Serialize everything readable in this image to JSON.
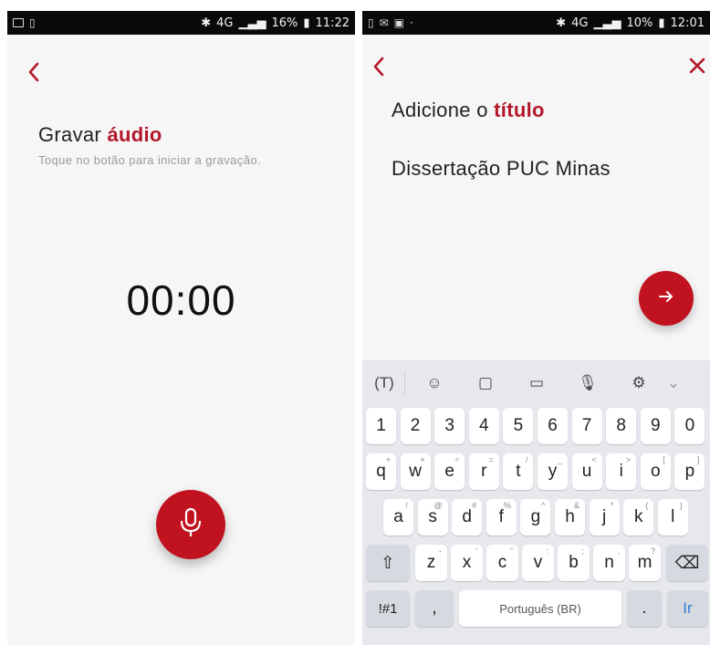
{
  "left_screen": {
    "status": {
      "network": "4G",
      "battery": "16%",
      "time": "11:22"
    },
    "title_prefix": "Gravar",
    "title_highlight": "áudio",
    "hint": "Toque no botão para iniciar a gravação.",
    "timer": "00:00"
  },
  "right_screen": {
    "status": {
      "network": "4G",
      "battery": "10%",
      "time": "12:01"
    },
    "prompt_prefix": "Adicione o",
    "prompt_highlight": "título",
    "title_value": "Dissertação PUC Minas"
  },
  "keyboard": {
    "number_row": [
      "1",
      "2",
      "3",
      "4",
      "5",
      "6",
      "7",
      "8",
      "9",
      "0"
    ],
    "row1": [
      {
        "k": "q",
        "h": "+"
      },
      {
        "k": "w",
        "h": "×"
      },
      {
        "k": "e",
        "h": "÷"
      },
      {
        "k": "r",
        "h": "="
      },
      {
        "k": "t",
        "h": "/"
      },
      {
        "k": "y",
        "h": "_"
      },
      {
        "k": "u",
        "h": "<"
      },
      {
        "k": "i",
        "h": ">"
      },
      {
        "k": "o",
        "h": "["
      },
      {
        "k": "p",
        "h": "]"
      }
    ],
    "row2": [
      {
        "k": "a",
        "h": "!"
      },
      {
        "k": "s",
        "h": "@"
      },
      {
        "k": "d",
        "h": "#"
      },
      {
        "k": "f",
        "h": "%"
      },
      {
        "k": "g",
        "h": "^"
      },
      {
        "k": "h",
        "h": "&"
      },
      {
        "k": "j",
        "h": "*"
      },
      {
        "k": "k",
        "h": "("
      },
      {
        "k": "l",
        "h": ")"
      }
    ],
    "row3": [
      {
        "k": "z",
        "h": "-"
      },
      {
        "k": "x",
        "h": "'"
      },
      {
        "k": "c",
        "h": "\""
      },
      {
        "k": "v",
        "h": ":"
      },
      {
        "k": "b",
        "h": ";"
      },
      {
        "k": "n",
        "h": ","
      },
      {
        "k": "m",
        "h": "?"
      }
    ],
    "symbols_label": "!#1",
    "comma_label": ",",
    "space_label": "Português (BR)",
    "period_label": ".",
    "go_label": "Ir"
  },
  "colors": {
    "accent": "#c1121f",
    "accent_text": "#b3182a",
    "keyboard_bg": "#e6e8ee"
  }
}
